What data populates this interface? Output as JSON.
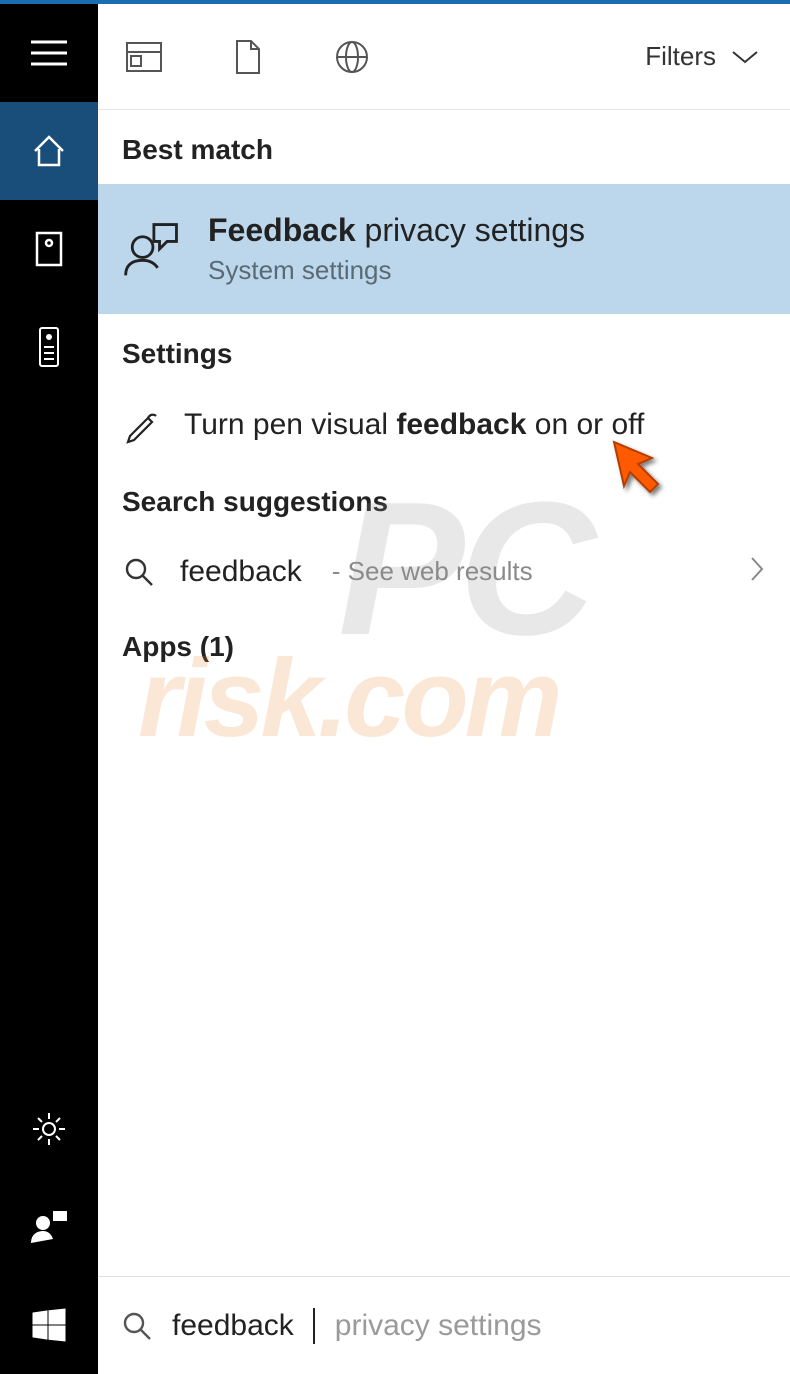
{
  "accent_color": "#1c6cb0",
  "top": {
    "filters_label": "Filters"
  },
  "sections": {
    "best_match": "Best match",
    "settings": "Settings",
    "search_suggestions": "Search suggestions",
    "apps": "Apps (1)"
  },
  "best_match_item": {
    "title_bold": "Feedback",
    "title_rest": " privacy settings",
    "subtitle": "System settings"
  },
  "settings_item": {
    "pre": "Turn pen visual ",
    "bold": "feedback",
    "post": " on or off"
  },
  "search_suggestion": {
    "query": "feedback",
    "hint": "- See web results"
  },
  "search_bar": {
    "typed": "feedback",
    "ghost": " privacy settings"
  }
}
